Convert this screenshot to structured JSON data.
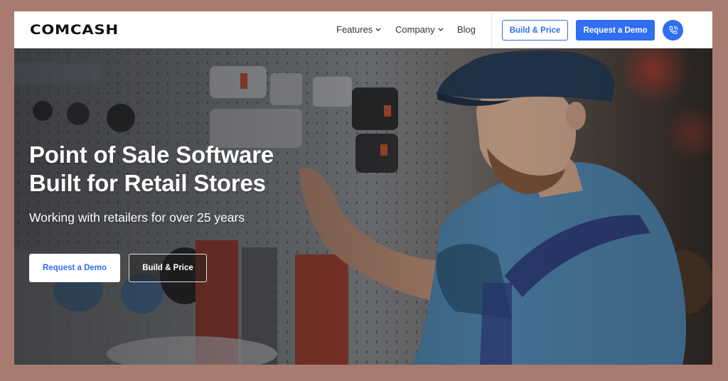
{
  "header": {
    "logo": "COMCASH",
    "nav": [
      {
        "label": "Features",
        "has_dropdown": true
      },
      {
        "label": "Company",
        "has_dropdown": true
      },
      {
        "label": "Blog",
        "has_dropdown": false
      }
    ],
    "build_price_label": "Build & Price",
    "request_demo_label": "Request a Demo",
    "phone_icon": "phone-ringing-icon"
  },
  "hero": {
    "title_line1": "Point of Sale Software",
    "title_line2": "Built for Retail Stores",
    "subtitle": "Working with retailers for over 25 years",
    "primary_button": "Request a Demo",
    "secondary_button": "Build & Price",
    "image_description": "Worker in cap and denim shirt arranging products on a retail store pegboard wall"
  },
  "colors": {
    "accent": "#2f6ff0",
    "frame": "#a87b70",
    "header_bg": "#ffffff",
    "text_dark": "#111111"
  }
}
